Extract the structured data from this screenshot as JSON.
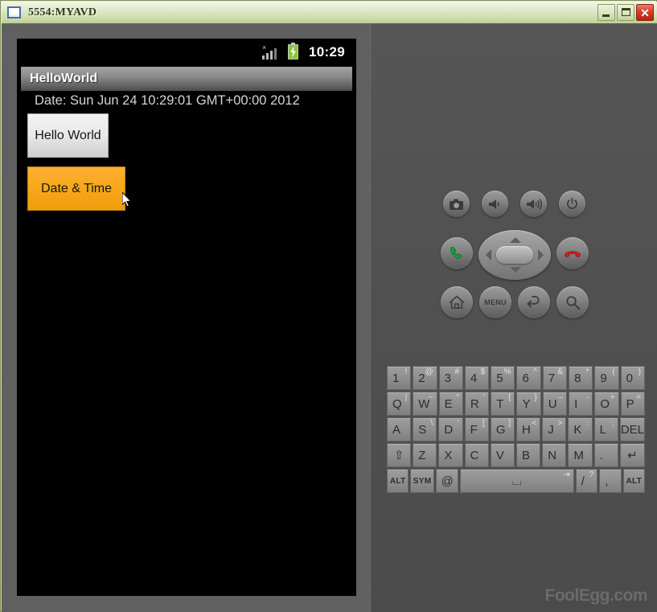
{
  "window": {
    "title": "5554:MYAVD",
    "icon": "app-window-icon",
    "controls": {
      "minimize": "Minimize",
      "maximize": "Maximize",
      "close": "Close"
    }
  },
  "phone": {
    "status_bar": {
      "signal_icon": "signal-bars-no-service-icon",
      "battery_icon": "battery-charging-icon",
      "clock": "10:29"
    },
    "app": {
      "title": "HelloWorld",
      "date_text": "Date: Sun Jun 24 10:29:01 GMT+00:00 2012",
      "buttons": [
        {
          "label": "Hello World",
          "state": "normal"
        },
        {
          "label": "Date & Time",
          "state": "focused"
        }
      ]
    },
    "cursor": "mouse-pointer"
  },
  "controls": {
    "hardware_buttons": [
      {
        "name": "camera-button",
        "icon": "camera-icon"
      },
      {
        "name": "volume-down-button",
        "icon": "volume-down-icon"
      },
      {
        "name": "volume-up-button",
        "icon": "volume-up-icon"
      },
      {
        "name": "power-button",
        "icon": "power-icon"
      },
      {
        "name": "call-button",
        "icon": "phone-green-icon"
      },
      {
        "name": "end-call-button",
        "icon": "phone-red-icon"
      },
      {
        "name": "home-button",
        "icon": "home-icon"
      },
      {
        "name": "menu-button",
        "icon": "menu-icon",
        "label": "MENU"
      },
      {
        "name": "back-button",
        "icon": "back-arrow-icon"
      },
      {
        "name": "search-button",
        "icon": "search-icon"
      }
    ],
    "dpad": {
      "up": "dpad-up",
      "down": "dpad-down",
      "left": "dpad-left",
      "right": "dpad-right",
      "center": "dpad-center"
    }
  },
  "keyboard": {
    "rows": [
      [
        {
          "main": "1",
          "alt": "!"
        },
        {
          "main": "2",
          "alt": "@"
        },
        {
          "main": "3",
          "alt": "#"
        },
        {
          "main": "4",
          "alt": "$"
        },
        {
          "main": "5",
          "alt": "%"
        },
        {
          "main": "6",
          "alt": "^"
        },
        {
          "main": "7",
          "alt": "&"
        },
        {
          "main": "8",
          "alt": "*"
        },
        {
          "main": "9",
          "alt": "("
        },
        {
          "main": "0",
          "alt": ")"
        }
      ],
      [
        {
          "main": "Q",
          "alt": "|"
        },
        {
          "main": "W",
          "alt": "~"
        },
        {
          "main": "E",
          "alt": "“"
        },
        {
          "main": "R",
          "alt": "‘"
        },
        {
          "main": "T",
          "alt": "{"
        },
        {
          "main": "Y",
          "alt": "}"
        },
        {
          "main": "U",
          "alt": "–"
        },
        {
          "main": "I",
          "alt": "-"
        },
        {
          "main": "O",
          "alt": "+"
        },
        {
          "main": "P",
          "alt": "="
        }
      ],
      [
        {
          "main": "A",
          "alt": ""
        },
        {
          "main": "S",
          "alt": "\\"
        },
        {
          "main": "D",
          "alt": "'"
        },
        {
          "main": "F",
          "alt": "["
        },
        {
          "main": "G",
          "alt": "]"
        },
        {
          "main": "H",
          "alt": "<"
        },
        {
          "main": "J",
          "alt": ">"
        },
        {
          "main": "K",
          "alt": ":"
        },
        {
          "main": "L",
          "alt": ";"
        },
        {
          "main": "DEL",
          "alt": "",
          "type": "del"
        }
      ],
      [
        {
          "main": "⇧",
          "alt": "",
          "type": "shift"
        },
        {
          "main": "Z",
          "alt": ""
        },
        {
          "main": "X",
          "alt": ""
        },
        {
          "main": "C",
          "alt": ""
        },
        {
          "main": "V",
          "alt": ""
        },
        {
          "main": "B",
          "alt": ""
        },
        {
          "main": "N",
          "alt": ""
        },
        {
          "main": "M",
          "alt": ""
        },
        {
          "main": ".",
          "alt": ""
        },
        {
          "main": "↵",
          "alt": "",
          "type": "enter"
        }
      ],
      [
        {
          "main": "ALT",
          "alt": "",
          "type": "label"
        },
        {
          "main": "SYM",
          "alt": "",
          "type": "label"
        },
        {
          "main": "@",
          "alt": ""
        },
        {
          "main": "⌴",
          "alt": "⇥",
          "type": "space"
        },
        {
          "main": "/",
          "alt": "?"
        },
        {
          "main": ",",
          "alt": ""
        },
        {
          "main": "ALT",
          "alt": "",
          "type": "label"
        }
      ]
    ]
  },
  "watermark": "FoolEgg.com"
}
